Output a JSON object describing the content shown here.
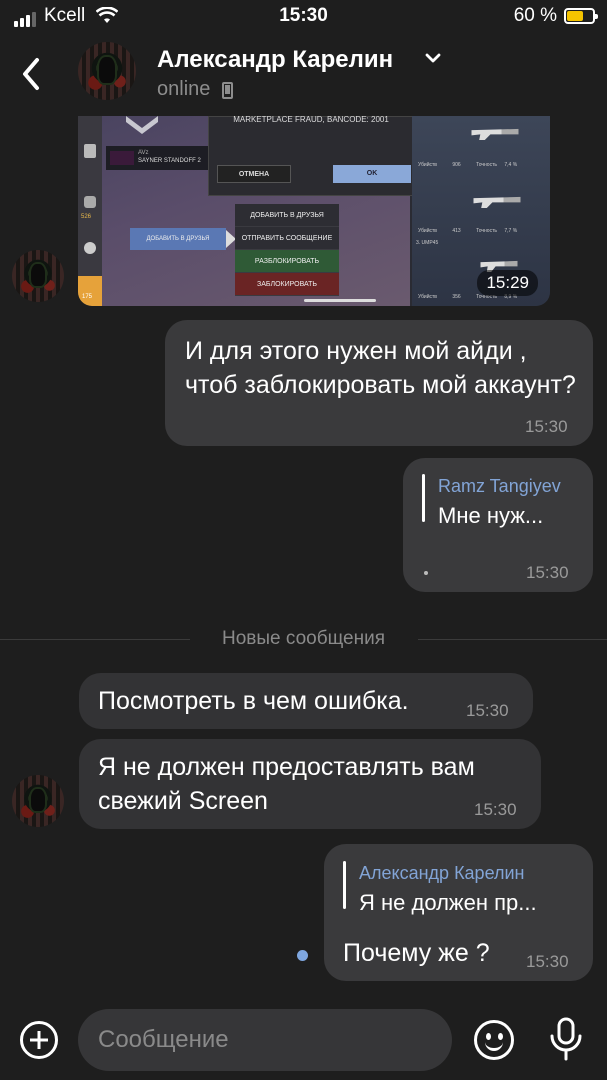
{
  "status_bar": {
    "carrier": "Kcell",
    "time": "15:30",
    "battery_percent": "60 %",
    "battery_level": 0.6,
    "battery_color": "#f5c400"
  },
  "header": {
    "contact_name": "Александр Карелин",
    "status": "online",
    "back_icon": "chevron-left-icon",
    "expand_icon": "chevron-down-icon",
    "device_icon": "phone-icon"
  },
  "media_message": {
    "time": "15:29",
    "game_text": {
      "dialog_title": "MARKETPLACE FRAUD, BANCODE: 2001",
      "cancel": "ОТМЕНА",
      "ok": "OK",
      "player_tag": "AVz",
      "player_name": "SAYNER STANDOFF 2",
      "add_friend_btn": "ДОБАВИТЬ В ДРУЗЬЯ",
      "menu": [
        "ДОБАВИТЬ В ДРУЗЬЯ",
        "ОТПРАВИТЬ СООБЩЕНИЕ",
        "РАЗБЛОКИРОВАТЬ",
        "ЗАБЛОКИРОВАТЬ"
      ],
      "side_numbers": [
        "526",
        "175"
      ],
      "stats": [
        {
          "kills_label": "Убийств",
          "kills": "906",
          "acc_label": "Точность",
          "acc": "7,4 %"
        },
        {
          "kills_label": "Убийств",
          "kills": "413",
          "acc_label": "Точность",
          "acc": "7,7 %"
        },
        {
          "kills_label": "Убийств",
          "kills": "356",
          "acc_label": "Точность",
          "acc": "8,9 %"
        }
      ],
      "weapon_label": "3. UMP45"
    }
  },
  "messages": [
    {
      "id": "m1",
      "direction": "out",
      "text": "И для этого нужен мой айди , чтоб заблокировать мой аккаунт?",
      "time": "15:30"
    },
    {
      "id": "m2",
      "direction": "out",
      "reply_name": "Ramz Tangiyev",
      "reply_text": "Мне нуж...",
      "text": "",
      "time": "15:30"
    },
    {
      "id": "m3",
      "direction": "in",
      "text": "Посмотреть в чем ошибка.",
      "time": "15:30"
    },
    {
      "id": "m4",
      "direction": "in",
      "text": "Я не должен предоставлять вам свежий Screen",
      "time": "15:30"
    },
    {
      "id": "m5",
      "direction": "out",
      "reply_name": "Александр Карелин",
      "reply_text": "Я не должен пр...",
      "text": "Почему же ?",
      "time": "15:30"
    }
  ],
  "divider_label": "Новые сообщения",
  "input": {
    "placeholder": "Сообщение",
    "attach_icon": "plus-circle-icon",
    "emoji_icon": "emoji-icon",
    "mic_icon": "microphone-icon"
  },
  "colors": {
    "background": "#1e1e1e",
    "bubble": "#3a3a3c",
    "reply_name": "#82a4d6",
    "unread_dot": "#7fa7e0"
  }
}
